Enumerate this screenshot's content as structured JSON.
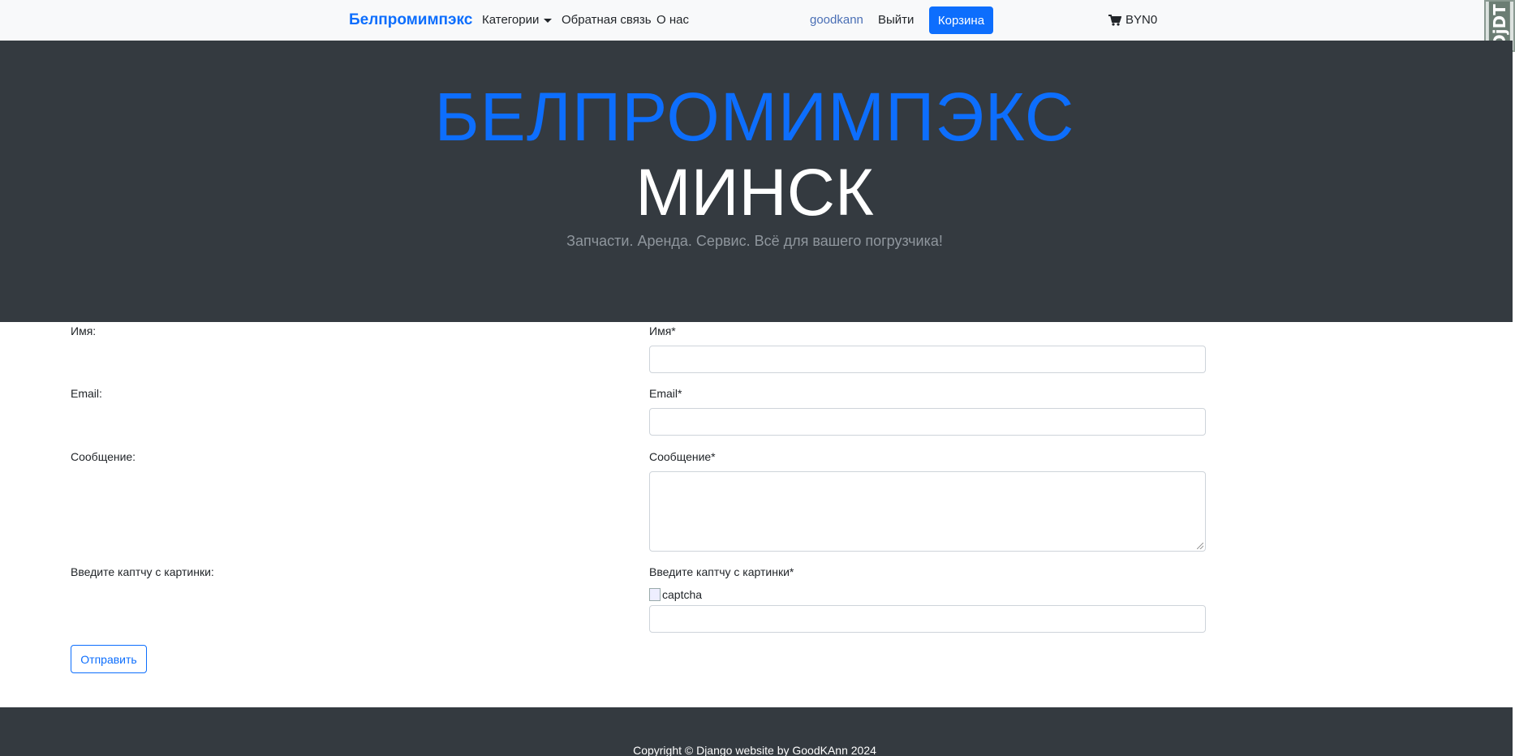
{
  "navbar": {
    "brand": "Белпромимпэкс",
    "items": [
      {
        "label": "Категории"
      },
      {
        "label": "Обратная связь"
      },
      {
        "label": "О нас"
      }
    ],
    "user": "goodkann",
    "logout": "Выйти",
    "cart_button": "Корзина",
    "cart_total": "BYN0",
    "cart_icon": "shopping-cart-icon",
    "debug_toolbar": "DjDT"
  },
  "hero": {
    "title": "БЕЛПРОМИМПЭКС",
    "city": "МИНСК",
    "subtitle": "Запчасти. Аренда. Сервис. Всё для вашего погрузчика!"
  },
  "form": {
    "left_labels": [
      "Имя:",
      "Email:",
      "Сообщение:",
      "Введите каптчу с картинки:"
    ],
    "fields": [
      {
        "label": "Имя*",
        "value": ""
      },
      {
        "label": "Email*",
        "value": ""
      },
      {
        "label": "Сообщение*",
        "value": ""
      },
      {
        "label": "Введите каптчу с картинки*",
        "value": ""
      }
    ],
    "captcha_alt": "captcha",
    "submit": "Отправить"
  },
  "footer": {
    "text": "Copyright © Django website by GoodKAnn 2024"
  },
  "colors": {
    "primary": "#0d6efd",
    "dark": "#343a40",
    "navbar_bg": "#f8f9fa"
  }
}
